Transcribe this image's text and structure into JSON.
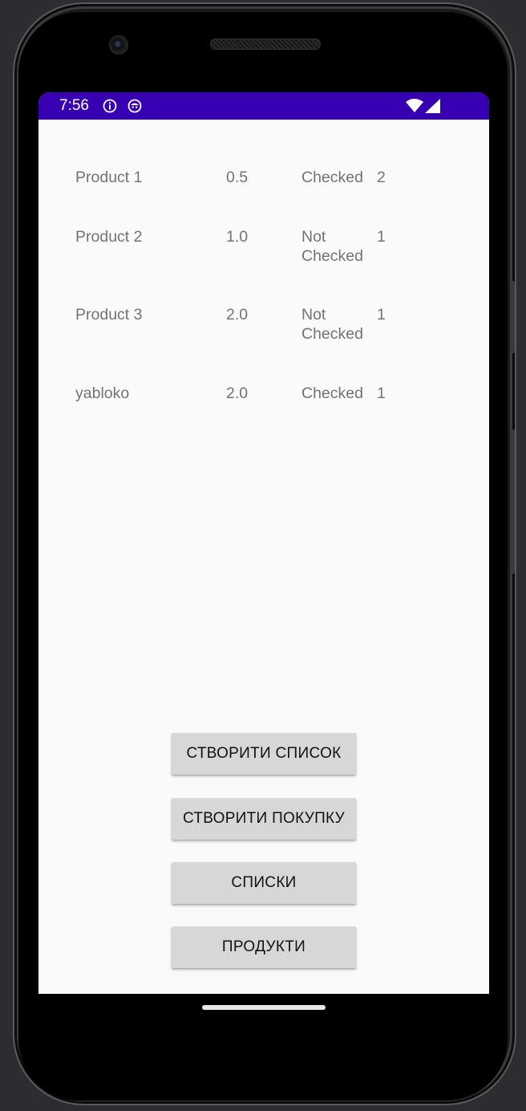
{
  "status_bar": {
    "time": "7:56",
    "left_icons": [
      "info-icon",
      "bot-icon"
    ],
    "right_icons": [
      "wifi-icon",
      "signal-icon"
    ],
    "color": "#3700b3"
  },
  "products": [
    {
      "name": "Product 1",
      "amount": "0.5",
      "status": "Checked",
      "count": "2"
    },
    {
      "name": "Product 2",
      "amount": "1.0",
      "status": "Not Checked",
      "count": "1"
    },
    {
      "name": "Product 3",
      "amount": "2.0",
      "status": "Not Checked",
      "count": "1"
    },
    {
      "name": "yabloko",
      "amount": "2.0",
      "status": "Checked",
      "count": "1"
    }
  ],
  "buttons": {
    "create_list": "СТВОРИТИ СПИСОК",
    "create_purchase": "СТВОРИТИ ПОКУПКУ",
    "lists": "СПИСКИ",
    "products": "ПРОДУКТИ"
  }
}
